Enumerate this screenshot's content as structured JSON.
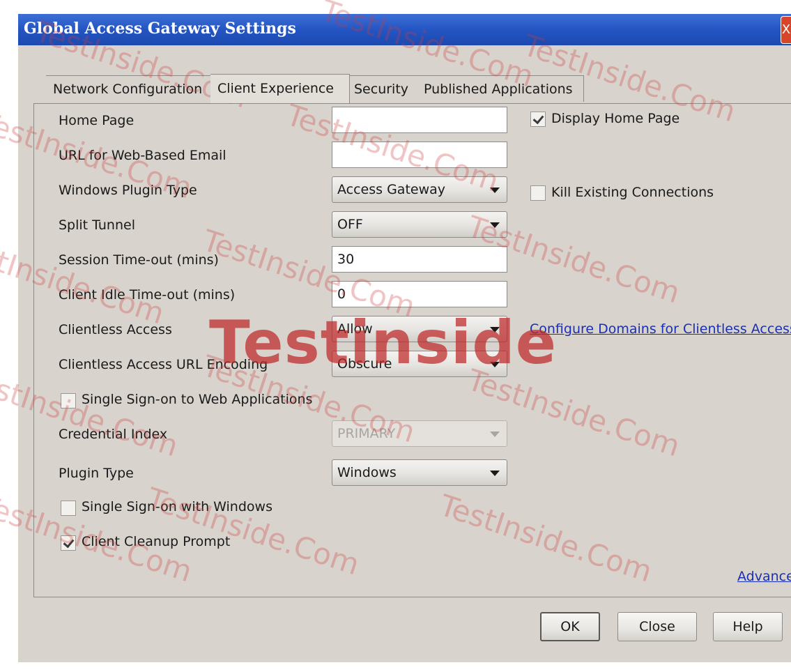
{
  "window": {
    "title": "Global Access Gateway Settings",
    "close_glyph": "X"
  },
  "tabs": [
    {
      "label": "Network Configuration"
    },
    {
      "label": "Client Experience"
    },
    {
      "label": "Security"
    },
    {
      "label": "Published Applications"
    }
  ],
  "form": {
    "home_page": {
      "label": "Home Page",
      "value": ""
    },
    "display_home_page": {
      "label": "Display Home Page",
      "checked": true
    },
    "web_email": {
      "label": "URL for Web-Based Email",
      "value": ""
    },
    "windows_plugin_type": {
      "label": "Windows Plugin Type",
      "value": "Access Gateway"
    },
    "kill_existing": {
      "label": "Kill Existing Connections",
      "checked": false
    },
    "split_tunnel": {
      "label": "Split Tunnel",
      "value": "OFF"
    },
    "session_timeout": {
      "label": "Session Time-out (mins)",
      "value": "30"
    },
    "client_idle_timeout": {
      "label": "Client Idle Time-out (mins)",
      "value": "0"
    },
    "clientless_access": {
      "label": "Clientless Access",
      "value": "Allow"
    },
    "configure_domains_link": "Configure Domains for Clientless Access",
    "clientless_url_encoding": {
      "label": "Clientless Access URL Encoding",
      "value": "Obscure"
    },
    "sso_web_apps": {
      "label": "Single Sign-on to Web Applications",
      "checked": false
    },
    "credential_index": {
      "label": "Credential Index",
      "value": "PRIMARY",
      "disabled": true
    },
    "plugin_type": {
      "label": "Plugin Type",
      "value": "Windows"
    },
    "sso_windows": {
      "label": "Single Sign-on with Windows",
      "checked": false
    },
    "client_cleanup": {
      "label": "Client Cleanup Prompt",
      "checked": true
    },
    "advanced_link": "Advanced"
  },
  "buttons": {
    "ok": "OK",
    "close": "Close",
    "help": "Help"
  },
  "watermark": {
    "main": "Testinside",
    "repeat": "TestInside.Com"
  },
  "colors": {
    "titlebar": "#2455c3",
    "dialog_bg": "#d8d4cd",
    "link": "#1a2fb3",
    "watermark": "#be2828"
  }
}
